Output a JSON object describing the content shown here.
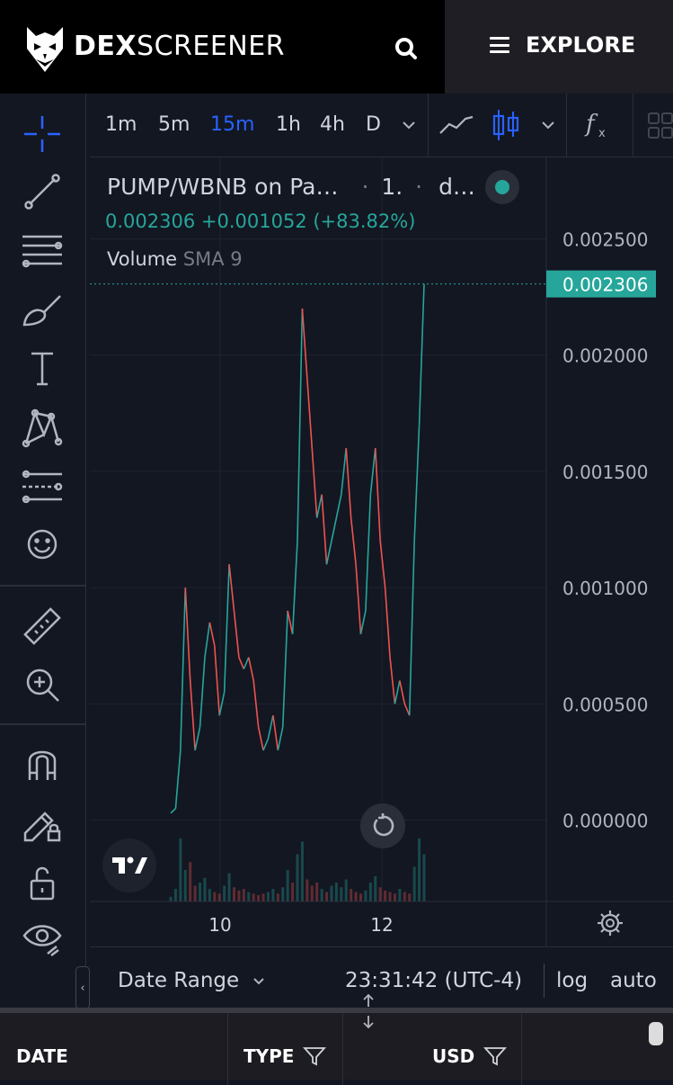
{
  "header": {
    "brand_bold": "DEX",
    "brand_light": "SCREENER",
    "explore_label": "EXPLORE",
    "logo_icon": "owl-logo-icon",
    "search_icon": "search-icon"
  },
  "left_toolbar": {
    "tools": [
      "crosshair-icon",
      "trend-line-icon",
      "fib-lines-icon",
      "brush-icon",
      "text-icon",
      "pattern-icon",
      "prediction-icon",
      "emoji-icon",
      "ruler-icon",
      "zoom-in-icon",
      "magnet-icon",
      "lock-drawing-icon",
      "unlock-icon",
      "eye-icon"
    ]
  },
  "timeframes": {
    "items": [
      "1m",
      "5m",
      "15m",
      "1h",
      "4h",
      "D"
    ],
    "active": "15m"
  },
  "legend": {
    "title": "PUMP/WBNB on Pa…",
    "interval": "1.",
    "extra": "d…",
    "change_line": "0.002306  +0.001052 (+83.82%)",
    "volume_label": "Volume",
    "volume_sma": "SMA 9"
  },
  "colors": {
    "up": "#26a69a",
    "down": "#ef5350",
    "accent": "#2962ff",
    "background": "#131722",
    "grid": "#2a2e39"
  },
  "chart_data": {
    "type": "line",
    "title": "PUMP/WBNB on Pa…",
    "ylabel": "",
    "xlabel": "",
    "x_ticks": [
      "10",
      "12"
    ],
    "y_ticks": [
      "0.002500",
      "0.002000",
      "0.001500",
      "0.001000",
      "0.000500",
      "0.000000"
    ],
    "ylim": [
      -0.00035,
      0.00285
    ],
    "last_price": "0.002306",
    "series": [
      {
        "values": [
          3e-05,
          5e-05,
          0.0003,
          0.001,
          0.0006,
          0.0003,
          0.0004,
          0.0007,
          0.00085,
          0.00075,
          0.00045,
          0.00055,
          0.0011,
          0.0009,
          0.0007,
          0.00065,
          0.0007,
          0.0006,
          0.0004,
          0.0003,
          0.00035,
          0.00045,
          0.0003,
          0.0004,
          0.0009,
          0.0008,
          0.0012,
          0.0022,
          0.0019,
          0.0016,
          0.0013,
          0.0014,
          0.0011,
          0.0012,
          0.0013,
          0.0014,
          0.0016,
          0.0013,
          0.0011,
          0.0008,
          0.0009,
          0.0014,
          0.0016,
          0.0012,
          0.001,
          0.0007,
          0.0005,
          0.0006,
          0.0005,
          0.00045,
          0.0012,
          0.0017,
          0.002306
        ],
        "ups": [
          1,
          1,
          1,
          1,
          0,
          0,
          1,
          1,
          1,
          0,
          0,
          1,
          1,
          0,
          0,
          0,
          1,
          0,
          0,
          0,
          1,
          1,
          0,
          1,
          1,
          0,
          1,
          1,
          0,
          0,
          0,
          1,
          0,
          1,
          1,
          1,
          1,
          0,
          0,
          0,
          1,
          1,
          1,
          0,
          0,
          0,
          0,
          1,
          0,
          0,
          1,
          1,
          1
        ]
      }
    ],
    "volume": [
      3,
      8,
      40,
      20,
      25,
      10,
      12,
      15,
      8,
      6,
      5,
      10,
      18,
      9,
      7,
      8,
      6,
      5,
      4,
      5,
      6,
      8,
      5,
      9,
      20,
      12,
      30,
      38,
      14,
      10,
      12,
      8,
      6,
      10,
      12,
      9,
      14,
      8,
      6,
      5,
      7,
      12,
      16,
      9,
      7,
      6,
      5,
      8,
      6,
      5,
      22,
      40,
      30
    ]
  },
  "bottom_bar": {
    "date_range": "Date Range",
    "time": "23:31:42 (UTC-4)",
    "log": "log",
    "auto": "auto"
  },
  "table_header": {
    "date": "DATE",
    "type": "TYPE",
    "usd": "USD"
  }
}
